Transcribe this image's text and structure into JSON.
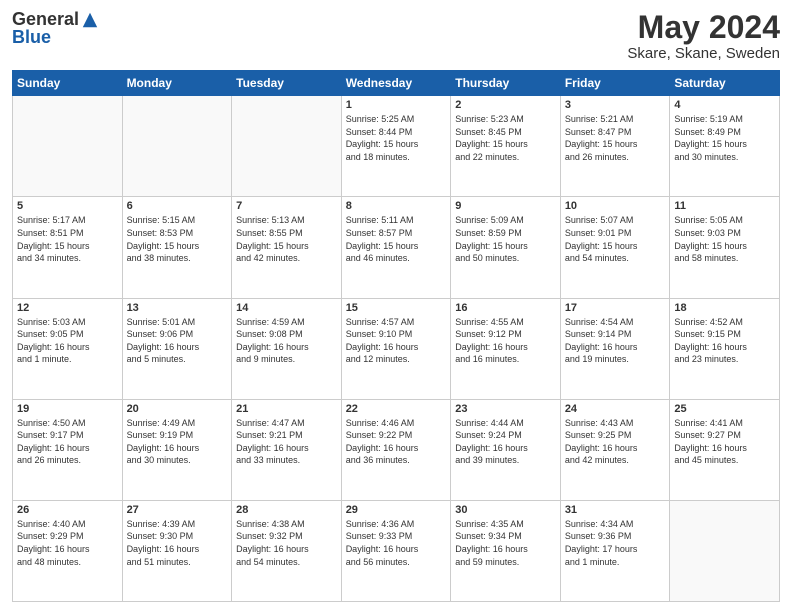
{
  "header": {
    "logo_general": "General",
    "logo_blue": "Blue",
    "month_title": "May 2024",
    "location": "Skare, Skane, Sweden"
  },
  "days_of_week": [
    "Sunday",
    "Monday",
    "Tuesday",
    "Wednesday",
    "Thursday",
    "Friday",
    "Saturday"
  ],
  "weeks": [
    [
      {
        "day": "",
        "info": ""
      },
      {
        "day": "",
        "info": ""
      },
      {
        "day": "",
        "info": ""
      },
      {
        "day": "1",
        "info": "Sunrise: 5:25 AM\nSunset: 8:44 PM\nDaylight: 15 hours\nand 18 minutes."
      },
      {
        "day": "2",
        "info": "Sunrise: 5:23 AM\nSunset: 8:45 PM\nDaylight: 15 hours\nand 22 minutes."
      },
      {
        "day": "3",
        "info": "Sunrise: 5:21 AM\nSunset: 8:47 PM\nDaylight: 15 hours\nand 26 minutes."
      },
      {
        "day": "4",
        "info": "Sunrise: 5:19 AM\nSunset: 8:49 PM\nDaylight: 15 hours\nand 30 minutes."
      }
    ],
    [
      {
        "day": "5",
        "info": "Sunrise: 5:17 AM\nSunset: 8:51 PM\nDaylight: 15 hours\nand 34 minutes."
      },
      {
        "day": "6",
        "info": "Sunrise: 5:15 AM\nSunset: 8:53 PM\nDaylight: 15 hours\nand 38 minutes."
      },
      {
        "day": "7",
        "info": "Sunrise: 5:13 AM\nSunset: 8:55 PM\nDaylight: 15 hours\nand 42 minutes."
      },
      {
        "day": "8",
        "info": "Sunrise: 5:11 AM\nSunset: 8:57 PM\nDaylight: 15 hours\nand 46 minutes."
      },
      {
        "day": "9",
        "info": "Sunrise: 5:09 AM\nSunset: 8:59 PM\nDaylight: 15 hours\nand 50 minutes."
      },
      {
        "day": "10",
        "info": "Sunrise: 5:07 AM\nSunset: 9:01 PM\nDaylight: 15 hours\nand 54 minutes."
      },
      {
        "day": "11",
        "info": "Sunrise: 5:05 AM\nSunset: 9:03 PM\nDaylight: 15 hours\nand 58 minutes."
      }
    ],
    [
      {
        "day": "12",
        "info": "Sunrise: 5:03 AM\nSunset: 9:05 PM\nDaylight: 16 hours\nand 1 minute."
      },
      {
        "day": "13",
        "info": "Sunrise: 5:01 AM\nSunset: 9:06 PM\nDaylight: 16 hours\nand 5 minutes."
      },
      {
        "day": "14",
        "info": "Sunrise: 4:59 AM\nSunset: 9:08 PM\nDaylight: 16 hours\nand 9 minutes."
      },
      {
        "day": "15",
        "info": "Sunrise: 4:57 AM\nSunset: 9:10 PM\nDaylight: 16 hours\nand 12 minutes."
      },
      {
        "day": "16",
        "info": "Sunrise: 4:55 AM\nSunset: 9:12 PM\nDaylight: 16 hours\nand 16 minutes."
      },
      {
        "day": "17",
        "info": "Sunrise: 4:54 AM\nSunset: 9:14 PM\nDaylight: 16 hours\nand 19 minutes."
      },
      {
        "day": "18",
        "info": "Sunrise: 4:52 AM\nSunset: 9:15 PM\nDaylight: 16 hours\nand 23 minutes."
      }
    ],
    [
      {
        "day": "19",
        "info": "Sunrise: 4:50 AM\nSunset: 9:17 PM\nDaylight: 16 hours\nand 26 minutes."
      },
      {
        "day": "20",
        "info": "Sunrise: 4:49 AM\nSunset: 9:19 PM\nDaylight: 16 hours\nand 30 minutes."
      },
      {
        "day": "21",
        "info": "Sunrise: 4:47 AM\nSunset: 9:21 PM\nDaylight: 16 hours\nand 33 minutes."
      },
      {
        "day": "22",
        "info": "Sunrise: 4:46 AM\nSunset: 9:22 PM\nDaylight: 16 hours\nand 36 minutes."
      },
      {
        "day": "23",
        "info": "Sunrise: 4:44 AM\nSunset: 9:24 PM\nDaylight: 16 hours\nand 39 minutes."
      },
      {
        "day": "24",
        "info": "Sunrise: 4:43 AM\nSunset: 9:25 PM\nDaylight: 16 hours\nand 42 minutes."
      },
      {
        "day": "25",
        "info": "Sunrise: 4:41 AM\nSunset: 9:27 PM\nDaylight: 16 hours\nand 45 minutes."
      }
    ],
    [
      {
        "day": "26",
        "info": "Sunrise: 4:40 AM\nSunset: 9:29 PM\nDaylight: 16 hours\nand 48 minutes."
      },
      {
        "day": "27",
        "info": "Sunrise: 4:39 AM\nSunset: 9:30 PM\nDaylight: 16 hours\nand 51 minutes."
      },
      {
        "day": "28",
        "info": "Sunrise: 4:38 AM\nSunset: 9:32 PM\nDaylight: 16 hours\nand 54 minutes."
      },
      {
        "day": "29",
        "info": "Sunrise: 4:36 AM\nSunset: 9:33 PM\nDaylight: 16 hours\nand 56 minutes."
      },
      {
        "day": "30",
        "info": "Sunrise: 4:35 AM\nSunset: 9:34 PM\nDaylight: 16 hours\nand 59 minutes."
      },
      {
        "day": "31",
        "info": "Sunrise: 4:34 AM\nSunset: 9:36 PM\nDaylight: 17 hours\nand 1 minute."
      },
      {
        "day": "",
        "info": ""
      }
    ]
  ]
}
